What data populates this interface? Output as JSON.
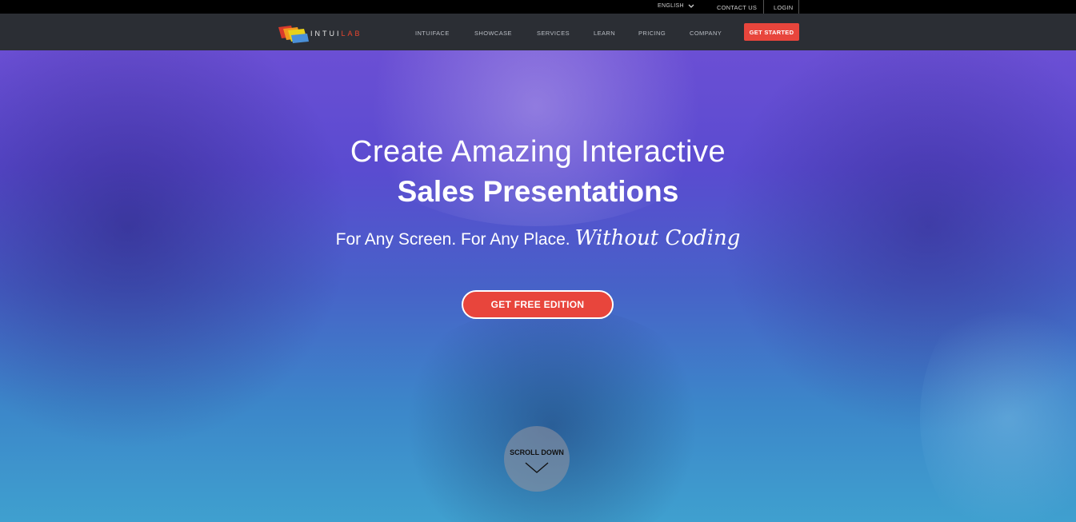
{
  "topbar": {
    "language": "ENGLISH",
    "contact": "CONTACT US",
    "login": "LOGIN"
  },
  "brand": {
    "logo_text_a": "INTUI",
    "logo_text_b": "LAB",
    "accent_color": "#e8453c"
  },
  "nav": {
    "items": [
      "INTUIFACE",
      "SHOWCASE",
      "SERVICES",
      "LEARN",
      "PRICING",
      "COMPANY"
    ],
    "cta": "GET STARTED"
  },
  "hero": {
    "title_line1": "Create Amazing Interactive",
    "title_line2": "Sales Presentations",
    "subtitle": "For Any Screen. For Any Place.",
    "subtitle_script": "Without Coding",
    "cta": "GET FREE EDITION",
    "scroll_label": "SCROLL DOWN"
  }
}
